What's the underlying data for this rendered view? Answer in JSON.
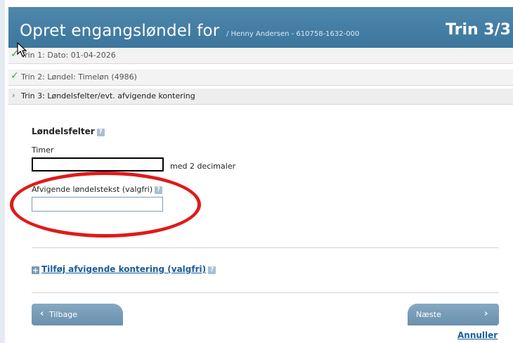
{
  "header": {
    "title": "Opret engangsløndel for",
    "subtitle": "/ Henny Andersen - 610758-1632-000",
    "step": "Trin 3/3"
  },
  "steps": [
    {
      "label": "Trin 1: Dato: 01-04-2026",
      "status": "done"
    },
    {
      "label": "Trin 2: Løndel: Timeløn (4986)",
      "status": "done"
    },
    {
      "label": "Trin 3: Løndelsfelter/evt. afvigende kontering",
      "status": "current"
    }
  ],
  "form": {
    "section_title": "Løndelsfelter",
    "help_glyph": "?",
    "hours_label": "Timer",
    "hours_value": "",
    "hours_hint": "med 2 decimaler",
    "text_label": "Afvigende løndelstekst (valgfri)",
    "text_value": ""
  },
  "add_link": {
    "plus_glyph": "+",
    "label": "Tilføj afvigende kontering (valgfri)"
  },
  "buttons": {
    "back_arrow": "‹",
    "back": "Tilbage",
    "next": "Næste",
    "next_arrow": "›",
    "cancel": "Annuller"
  },
  "colors": {
    "header": "#3f79a0",
    "button": "#7399b5",
    "link": "#1b5d9a",
    "annotation": "#e01a1a",
    "check": "#3da83d"
  },
  "icons": {
    "cursor": "cursor-icon",
    "check": "check-icon",
    "chevron": "chevron-right-icon",
    "help": "help-icon",
    "plus": "plus-icon"
  }
}
